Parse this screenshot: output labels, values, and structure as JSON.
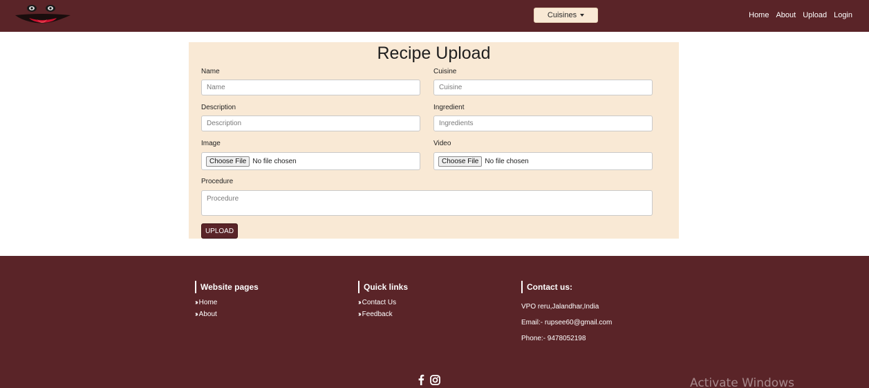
{
  "navbar": {
    "cuisines_label": "Cuisines",
    "links": [
      "Home",
      "About",
      "Upload",
      "Login"
    ]
  },
  "form": {
    "title": "Recipe Upload",
    "name": {
      "label": "Name",
      "placeholder": "Name"
    },
    "cuisine": {
      "label": "Cuisine",
      "placeholder": "Cuisine"
    },
    "description": {
      "label": "Description",
      "placeholder": "Description"
    },
    "ingredient": {
      "label": "Ingredient",
      "placeholder": "Ingredients"
    },
    "image": {
      "label": "Image",
      "button": "Choose File",
      "status": "No file chosen"
    },
    "video": {
      "label": "Video",
      "button": "Choose File",
      "status": "No file chosen"
    },
    "procedure": {
      "label": "Procedure",
      "placeholder": "Procedure"
    },
    "submit_label": "UPLOAD"
  },
  "footer": {
    "website_pages": {
      "heading": "Website pages",
      "links": [
        "Home",
        "About"
      ]
    },
    "quick_links": {
      "heading": "Quick links",
      "links": [
        "Contact Us",
        "Feedback"
      ]
    },
    "contact": {
      "heading": "Contact us:",
      "address": "VPO reru,Jalandhar,India",
      "email": "Email:- rupsee60@gmail.com",
      "phone": "Phone:- 9478052198"
    },
    "social_icons": [
      "facebook-icon",
      "instagram-icon"
    ]
  },
  "watermark": "Activate Windows",
  "colors": {
    "primary": "#5a2428",
    "form_background": "#f9e9d5"
  }
}
